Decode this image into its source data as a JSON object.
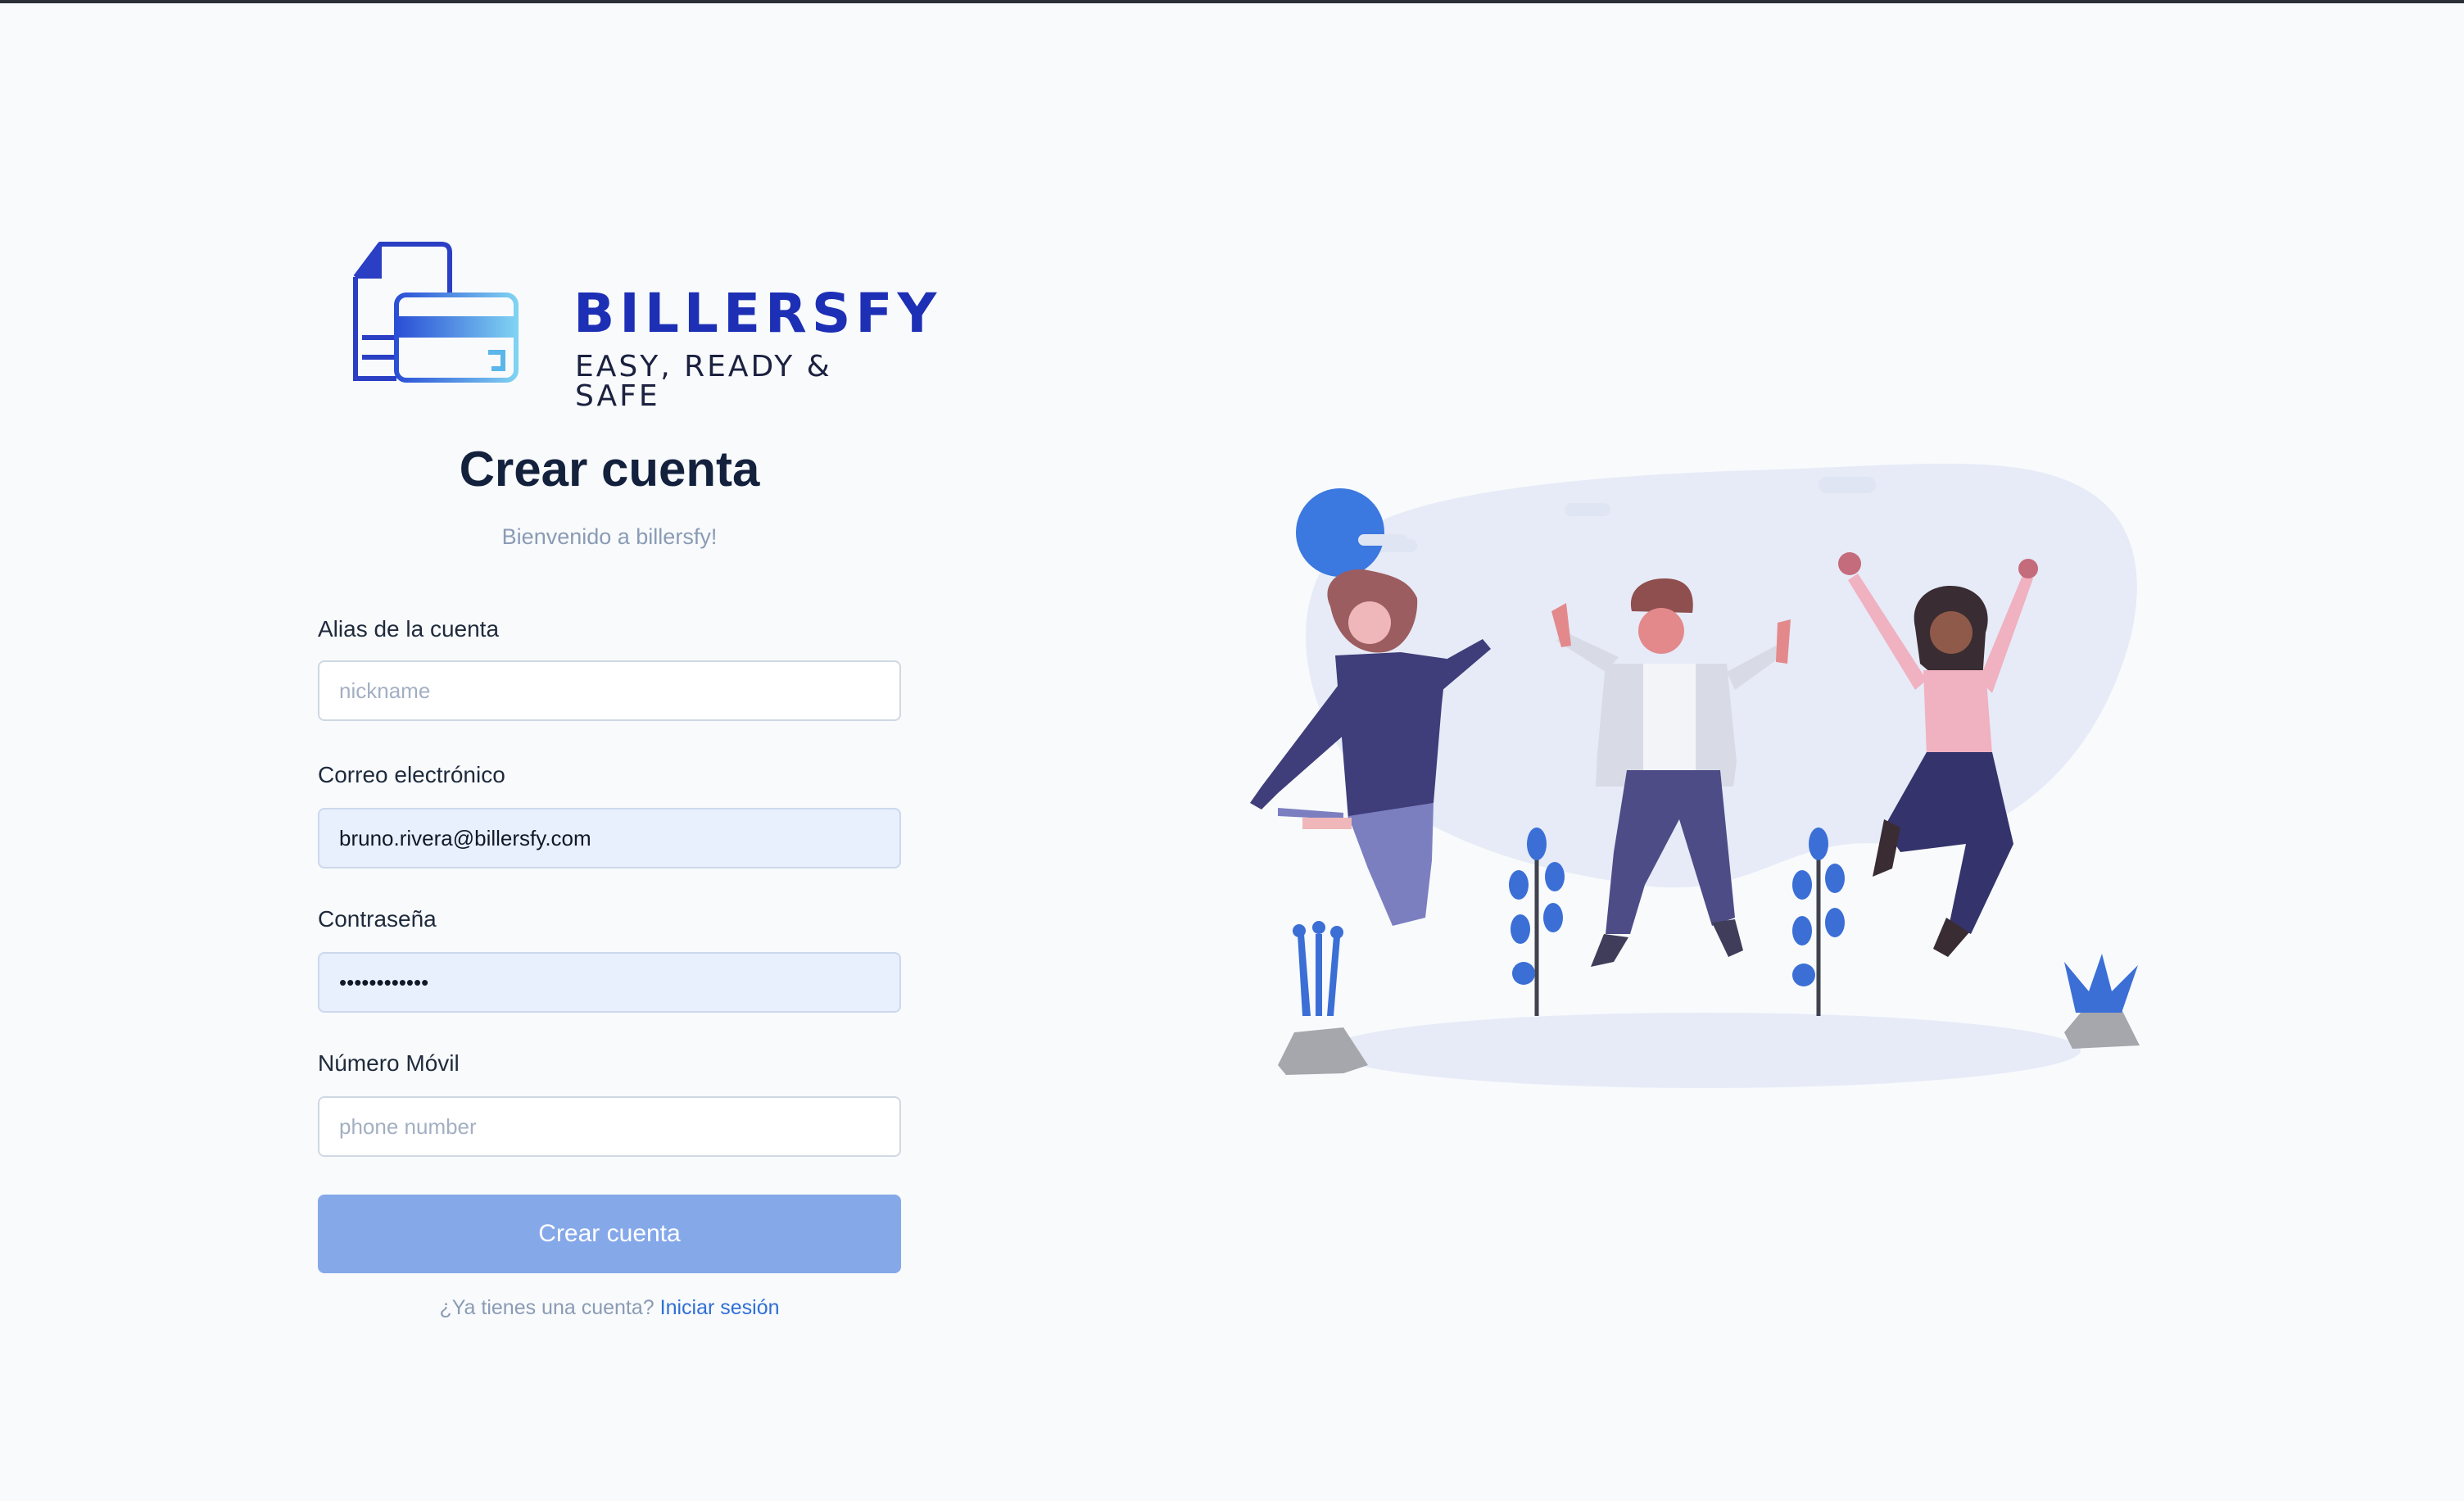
{
  "brand": {
    "name": "BILLERSFY",
    "tagline": "EASY, READY & SAFE"
  },
  "header": {
    "title": "Crear cuenta",
    "subtitle": "Bienvenido a billersfy!"
  },
  "form": {
    "alias": {
      "label": "Alias de la cuenta",
      "placeholder": "nickname",
      "value": ""
    },
    "email": {
      "label": "Correo electrónico",
      "placeholder": "",
      "value": "bruno.rivera@billersfy.com"
    },
    "password": {
      "label": "Contraseña",
      "placeholder": "",
      "value": "••••••••••••"
    },
    "phone": {
      "label": "Número Móvil",
      "placeholder": "phone number",
      "value": ""
    },
    "submit_label": "Crear cuenta"
  },
  "footer": {
    "prompt": "¿Ya tienes una cuenta?",
    "login_link": "Iniciar sesión"
  },
  "colors": {
    "brand_blue": "#1d2fb5",
    "button": "#85a8e9",
    "link": "#2f6fd6"
  }
}
